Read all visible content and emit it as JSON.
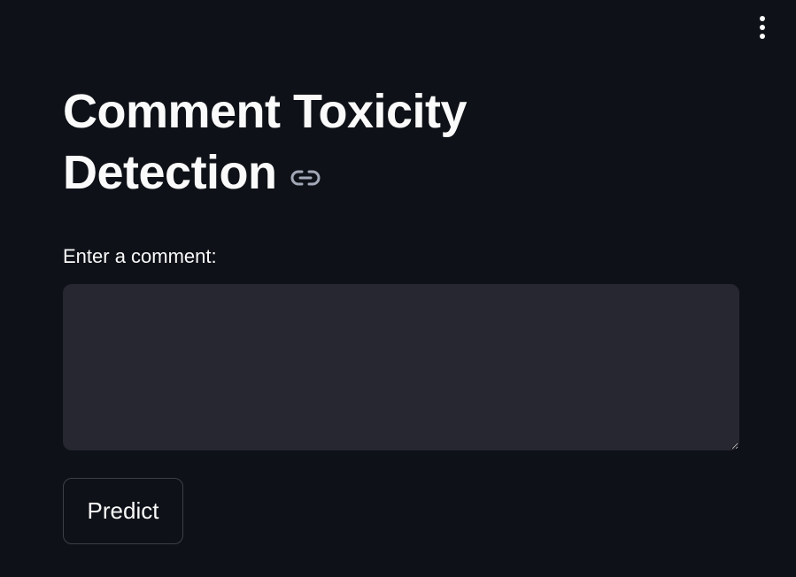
{
  "header": {
    "menu_icon": "kebab-vertical-icon"
  },
  "main": {
    "title": "Comment Toxicity Detection",
    "anchor_icon": "link-icon",
    "input": {
      "label": "Enter a comment:",
      "value": "",
      "placeholder": ""
    },
    "predict_label": "Predict"
  },
  "colors": {
    "background": "#0e1117",
    "text": "#fafafa",
    "input_background": "#262730",
    "button_border": "#3d4049",
    "icon": "#a3a8b8"
  }
}
